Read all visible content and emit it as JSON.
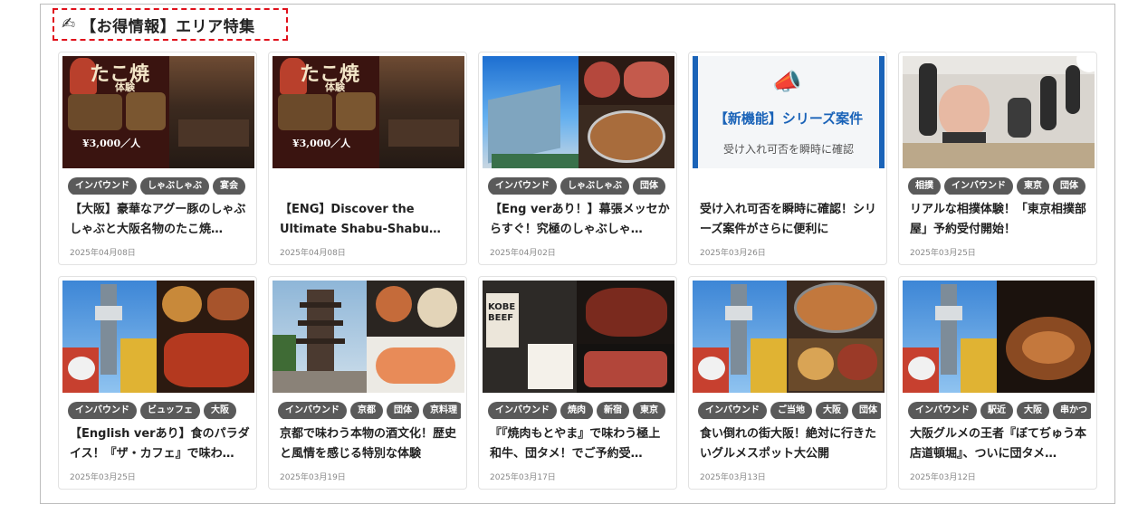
{
  "section": {
    "icon": "pencil-hand-icon",
    "title": "【お得情報】エリア特集"
  },
  "cards": [
    {
      "tags": [
        "インバウンド",
        "しゃぶしゃぶ",
        "宴会"
      ],
      "title": "【大阪】豪華なアグー豚のしゃぶしゃぶと大阪名物のたこ焼…",
      "date": "2025年04月08日",
      "image": {
        "kind": "takoyaki",
        "lettering": "たこ焼",
        "sub": "体験",
        "price": "¥3,000／人"
      }
    },
    {
      "tags": [],
      "title": "【ENG】Discover the Ultimate Shabu-Shabu and…",
      "date": "2025年04月08日",
      "image": {
        "kind": "takoyaki",
        "lettering": "たこ焼",
        "sub": "体験",
        "price": "¥3,000／人"
      }
    },
    {
      "tags": [
        "インバウンド",
        "しゃぶしゃぶ",
        "団体"
      ],
      "title": "【Eng verあり！】幕張メッセからすぐ！究極のしゃぶしゃ…",
      "date": "2025年04月02日",
      "image": {
        "kind": "makuhari"
      }
    },
    {
      "tags": [],
      "title": "受け入れ可否を瞬時に確認！シリーズ案件がさらに便利に",
      "date": "2025年03月26日",
      "image": {
        "kind": "notice",
        "headline": "【新機能】シリーズ案件",
        "subline": "受け入れ可否を瞬時に確認",
        "accent": "#1a63b8"
      }
    },
    {
      "tags": [
        "相撲",
        "インバウンド",
        "東京",
        "団体"
      ],
      "title": "リアルな相撲体験！「東京相撲部屋」予約受付開始！",
      "date": "2025年03月25日",
      "image": {
        "kind": "sumo"
      }
    },
    {
      "tags": [
        "インバウンド",
        "ビュッフェ",
        "大阪"
      ],
      "title": "【English verあり】食のパラダイス！『ザ・カフェ』で味わ…",
      "date": "2025年03月25日",
      "image": {
        "kind": "tower-buffet"
      }
    },
    {
      "tags": [
        "インバウンド",
        "京都",
        "団体",
        "京料理"
      ],
      "title": "京都で味わう本物の酒文化！歴史と風情を感じる特別な体験",
      "date": "2025年03月19日",
      "image": {
        "kind": "kyoto"
      }
    },
    {
      "tags": [
        "インバウンド",
        "焼肉",
        "新宿",
        "東京"
      ],
      "title": "『『焼肉もとやま』で味わう極上和牛、団タメ！でご予約受…",
      "date": "2025年03月17日",
      "image": {
        "kind": "yakiniku",
        "sign": "KOBE BEEF"
      }
    },
    {
      "tags": [
        "インバウンド",
        "ご当地",
        "大阪",
        "団体"
      ],
      "title": "食い倒れの街大阪！絶対に行きたいグルメスポット大公開",
      "date": "2025年03月13日",
      "image": {
        "kind": "tower-shabu"
      }
    },
    {
      "tags": [
        "インバウンド",
        "駅近",
        "大阪",
        "串かつ"
      ],
      "title": "大阪グルメの王者『ぼてぢゅう本店道頓堀』、ついに団タメ…",
      "date": "2025年03月12日",
      "image": {
        "kind": "tower-okonomi"
      }
    }
  ]
}
